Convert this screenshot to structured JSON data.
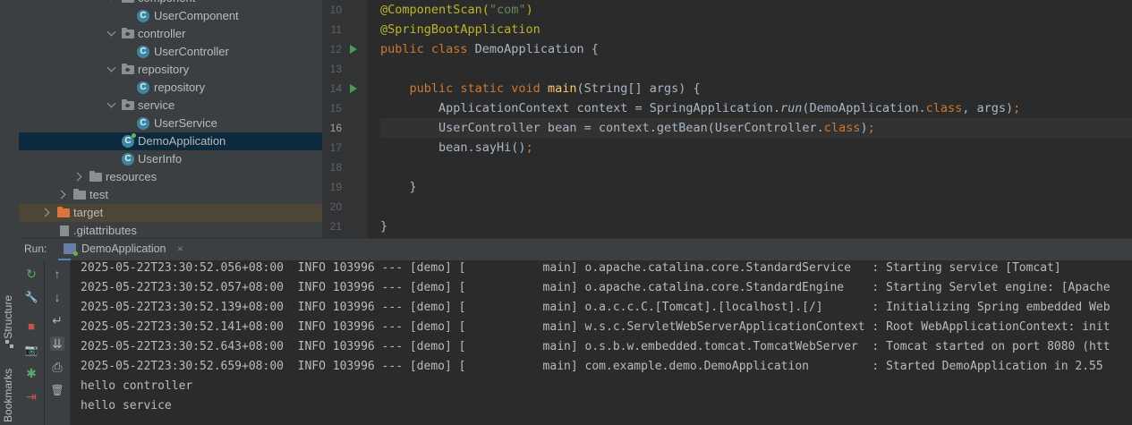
{
  "sidebar": {
    "structure_label": "Structure",
    "bookmarks_label": "Bookmarks"
  },
  "tree": {
    "items": [
      {
        "label": "component"
      },
      {
        "label": "UserComponent"
      },
      {
        "label": "controller"
      },
      {
        "label": "UserController"
      },
      {
        "label": "repository"
      },
      {
        "label": "repository"
      },
      {
        "label": "service"
      },
      {
        "label": "UserService"
      },
      {
        "label": "DemoApplication"
      },
      {
        "label": "UserInfo"
      },
      {
        "label": "resources"
      },
      {
        "label": "test"
      },
      {
        "label": "target"
      },
      {
        "label": ".gitattributes"
      }
    ]
  },
  "editor": {
    "line_numbers": [
      "10",
      "11",
      "12",
      "13",
      "14",
      "15",
      "16",
      "17",
      "18",
      "19",
      "20",
      "21"
    ],
    "code": {
      "l10_ann": "@ComponentScan(",
      "l10_str": "\"com\"",
      "l10_end": ")",
      "l11": "@SpringBootApplication",
      "l12_kw": "public class ",
      "l12_rest": "DemoApplication {",
      "l14_indent": "    ",
      "l14_kw": "public static void ",
      "l14_fn": "main",
      "l14_rest": "(String[] args) {",
      "l15_a": "        ApplicationContext context = SpringApplication.",
      "l15_run": "run",
      "l15_b": "(DemoApplication.",
      "l15_cls": "class",
      "l15_c": ", args)",
      "l15_semi": ";",
      "l16_a": "        UserController bean = context.getBean(UserController.",
      "l16_cls": "class",
      "l16_b": ")",
      "l16_semi": ";",
      "l17_a": "        bean.sayHi()",
      "l17_semi": ";",
      "l19": "    }",
      "l21": "}"
    }
  },
  "run": {
    "label": "Run:",
    "tab_label": "DemoApplication",
    "close_glyph": "×"
  },
  "console": {
    "lines": [
      "2025-05-22T23:30:52.056+08:00  INFO 103996 --- [demo] [           main] o.apache.catalina.core.StandardService   : Starting service [Tomcat]",
      "2025-05-22T23:30:52.057+08:00  INFO 103996 --- [demo] [           main] o.apache.catalina.core.StandardEngine    : Starting Servlet engine: [Apache",
      "2025-05-22T23:30:52.139+08:00  INFO 103996 --- [demo] [           main] o.a.c.c.C.[Tomcat].[localhost].[/]       : Initializing Spring embedded Web",
      "2025-05-22T23:30:52.141+08:00  INFO 103996 --- [demo] [           main] w.s.c.ServletWebServerApplicationContext : Root WebApplicationContext: init",
      "2025-05-22T23:30:52.643+08:00  INFO 103996 --- [demo] [           main] o.s.b.w.embedded.tomcat.TomcatWebServer  : Tomcat started on port 8080 (htt",
      "2025-05-22T23:30:52.659+08:00  INFO 103996 --- [demo] [           main] com.example.demo.DemoApplication         : Started DemoApplication in 2.55",
      "hello controller",
      "hello service"
    ]
  },
  "icons": {
    "rerun": "↻",
    "wrench": "🔧",
    "stop": "■",
    "camera": "📷",
    "bug": "✱",
    "exit": "⇥",
    "up": "↑",
    "down": "↓",
    "wrap": "↵",
    "scroll": "⇊",
    "print": "⎙",
    "trash": "🗑"
  }
}
